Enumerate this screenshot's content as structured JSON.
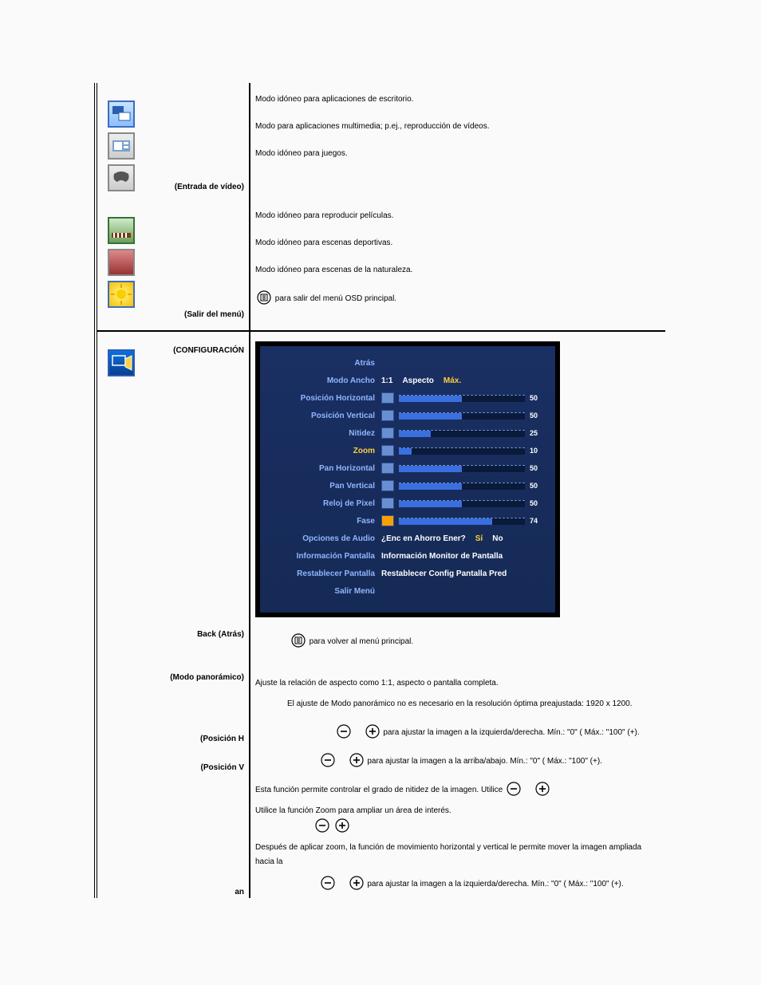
{
  "section1": {
    "video_input_label": "(Entrada de vídeo)",
    "exit_menu_label": "(Salir del menú)",
    "mode_desktop": "Modo idóneo para aplicaciones de escritorio.",
    "mode_multimedia": "Modo para aplicaciones multimedia; p.ej., reproducción de vídeos.",
    "mode_games": "Modo idóneo para juegos.",
    "mode_movies": "Modo idóneo para reproducir películas.",
    "mode_sports": "Modo idóneo para escenas deportivas.",
    "mode_nature": "Modo idóneo para escenas de la naturaleza.",
    "exit_text": " para salir del menú OSD principal."
  },
  "section2": {
    "config_label": "(CONFIGURACIÓN",
    "back_label": "Back (Atrás)",
    "wide_label": "(Modo panorámico)",
    "hpos_label": "(Posición H",
    "vpos_label": "(Posición V",
    "an_label": "an",
    "back_text": " para volver al menú principal.",
    "wide_text1": "Ajuste la relación de aspecto como 1:1, aspecto o pantalla completa.",
    "wide_text2": "El ajuste de Modo panorámico no es necesario en la resolución óptima preajustada: 1920 x 1200.",
    "hpos_text": " para ajustar la imagen a la izquierda/derecha. Mín.: \"0\" (    Máx.: \"100\" (+).",
    "vpos_text": " para ajustar la imagen a la arriba/abajo. Mín.: \"0\" (    Máx.: \"100\" (+).",
    "sharp_text": "Esta función permite controlar el grado de nitidez de la imagen. Utilice ",
    "zoom_text": "Utilice la función Zoom para ampliar un área de interés.",
    "pan_text": "Después de aplicar zoom, la función de movimiento horizontal y vertical le permite mover la imagen ampliada hacia la",
    "pan_text2": " para ajustar la imagen a la izquierda/derecha. Mín.: \"0\" (    Máx.: \"100\" (+)."
  },
  "osd": {
    "back": "Atrás",
    "wide": "Modo Ancho",
    "wide_opts": {
      "a": "1:1",
      "b": "Aspecto",
      "c": "Máx."
    },
    "hpos": "Posición Horizontal",
    "vpos": "Posición Vertical",
    "sharp": "Nitidez",
    "zoom": "Zoom",
    "panh": "Pan Horizontal",
    "panv": "Pan Vertical",
    "pixel": "Reloj de Pixel",
    "phase": "Fase",
    "audio": "Opciones de Audio",
    "audio_q": "¿Enc en Ahorro Ener?",
    "audio_yes": "Sí",
    "audio_no": "No",
    "info": "Información Pantalla",
    "info_v": "Información Monitor de Pantalla",
    "reset": "Restablecer Pantalla",
    "reset_v": "Restablecer Config Pantalla Pred",
    "exit": "Salir Menú"
  },
  "chart_data": {
    "type": "table",
    "title": "OSD Display Settings sliders",
    "rows": [
      {
        "label": "Posición Horizontal",
        "value": 50,
        "min": 0,
        "max": 100
      },
      {
        "label": "Posición Vertical",
        "value": 50,
        "min": 0,
        "max": 100
      },
      {
        "label": "Nitidez",
        "value": 25,
        "min": 0,
        "max": 100
      },
      {
        "label": "Zoom",
        "value": 10,
        "min": 0,
        "max": 100
      },
      {
        "label": "Pan Horizontal",
        "value": 50,
        "min": 0,
        "max": 100
      },
      {
        "label": "Pan Vertical",
        "value": 50,
        "min": 0,
        "max": 100
      },
      {
        "label": "Reloj de Pixel",
        "value": 50,
        "min": 0,
        "max": 100
      },
      {
        "label": "Fase",
        "value": 74,
        "min": 0,
        "max": 100
      }
    ]
  }
}
